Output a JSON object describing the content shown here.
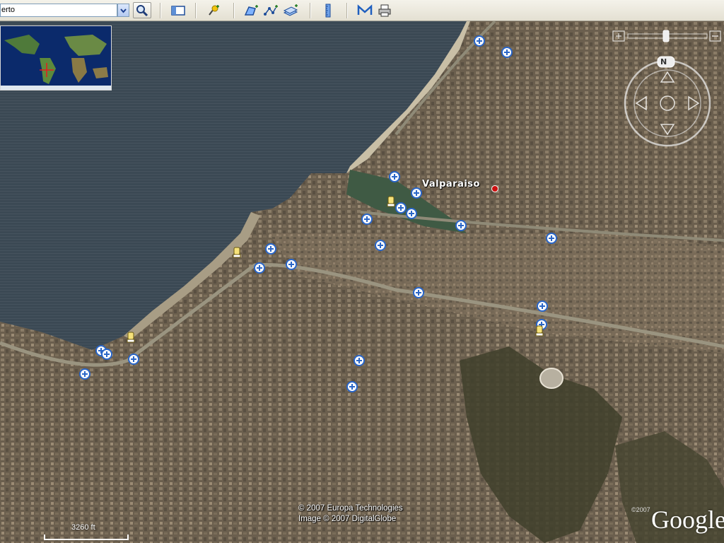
{
  "toolbar": {
    "search_value": "erto",
    "buttons": [
      {
        "name": "sidebar-toggle-button",
        "icon": "sidebar-icon"
      },
      {
        "name": "add-placemark-button",
        "icon": "placemark-icon"
      },
      {
        "name": "add-polygon-button",
        "icon": "polygon-icon"
      },
      {
        "name": "add-path-button",
        "icon": "path-icon"
      },
      {
        "name": "add-overlay-button",
        "icon": "overlay-icon"
      },
      {
        "name": "ruler-button",
        "icon": "ruler-icon"
      },
      {
        "name": "email-button",
        "icon": "email-icon"
      },
      {
        "name": "print-button",
        "icon": "print-icon"
      }
    ]
  },
  "map": {
    "place_label": "Valparaiso",
    "credits": [
      "© 2007 Europa Technologies",
      "Image © 2007 DigitalGlobe"
    ],
    "scale_legend": "3260 ft",
    "small_copyright": "©2007",
    "logo": "Google",
    "compass_north": "N"
  },
  "colors": {
    "sea": "#3c4a55",
    "land": "#6b5f4e",
    "marker": "#2a66c8",
    "place_dot": "#cc1010"
  }
}
